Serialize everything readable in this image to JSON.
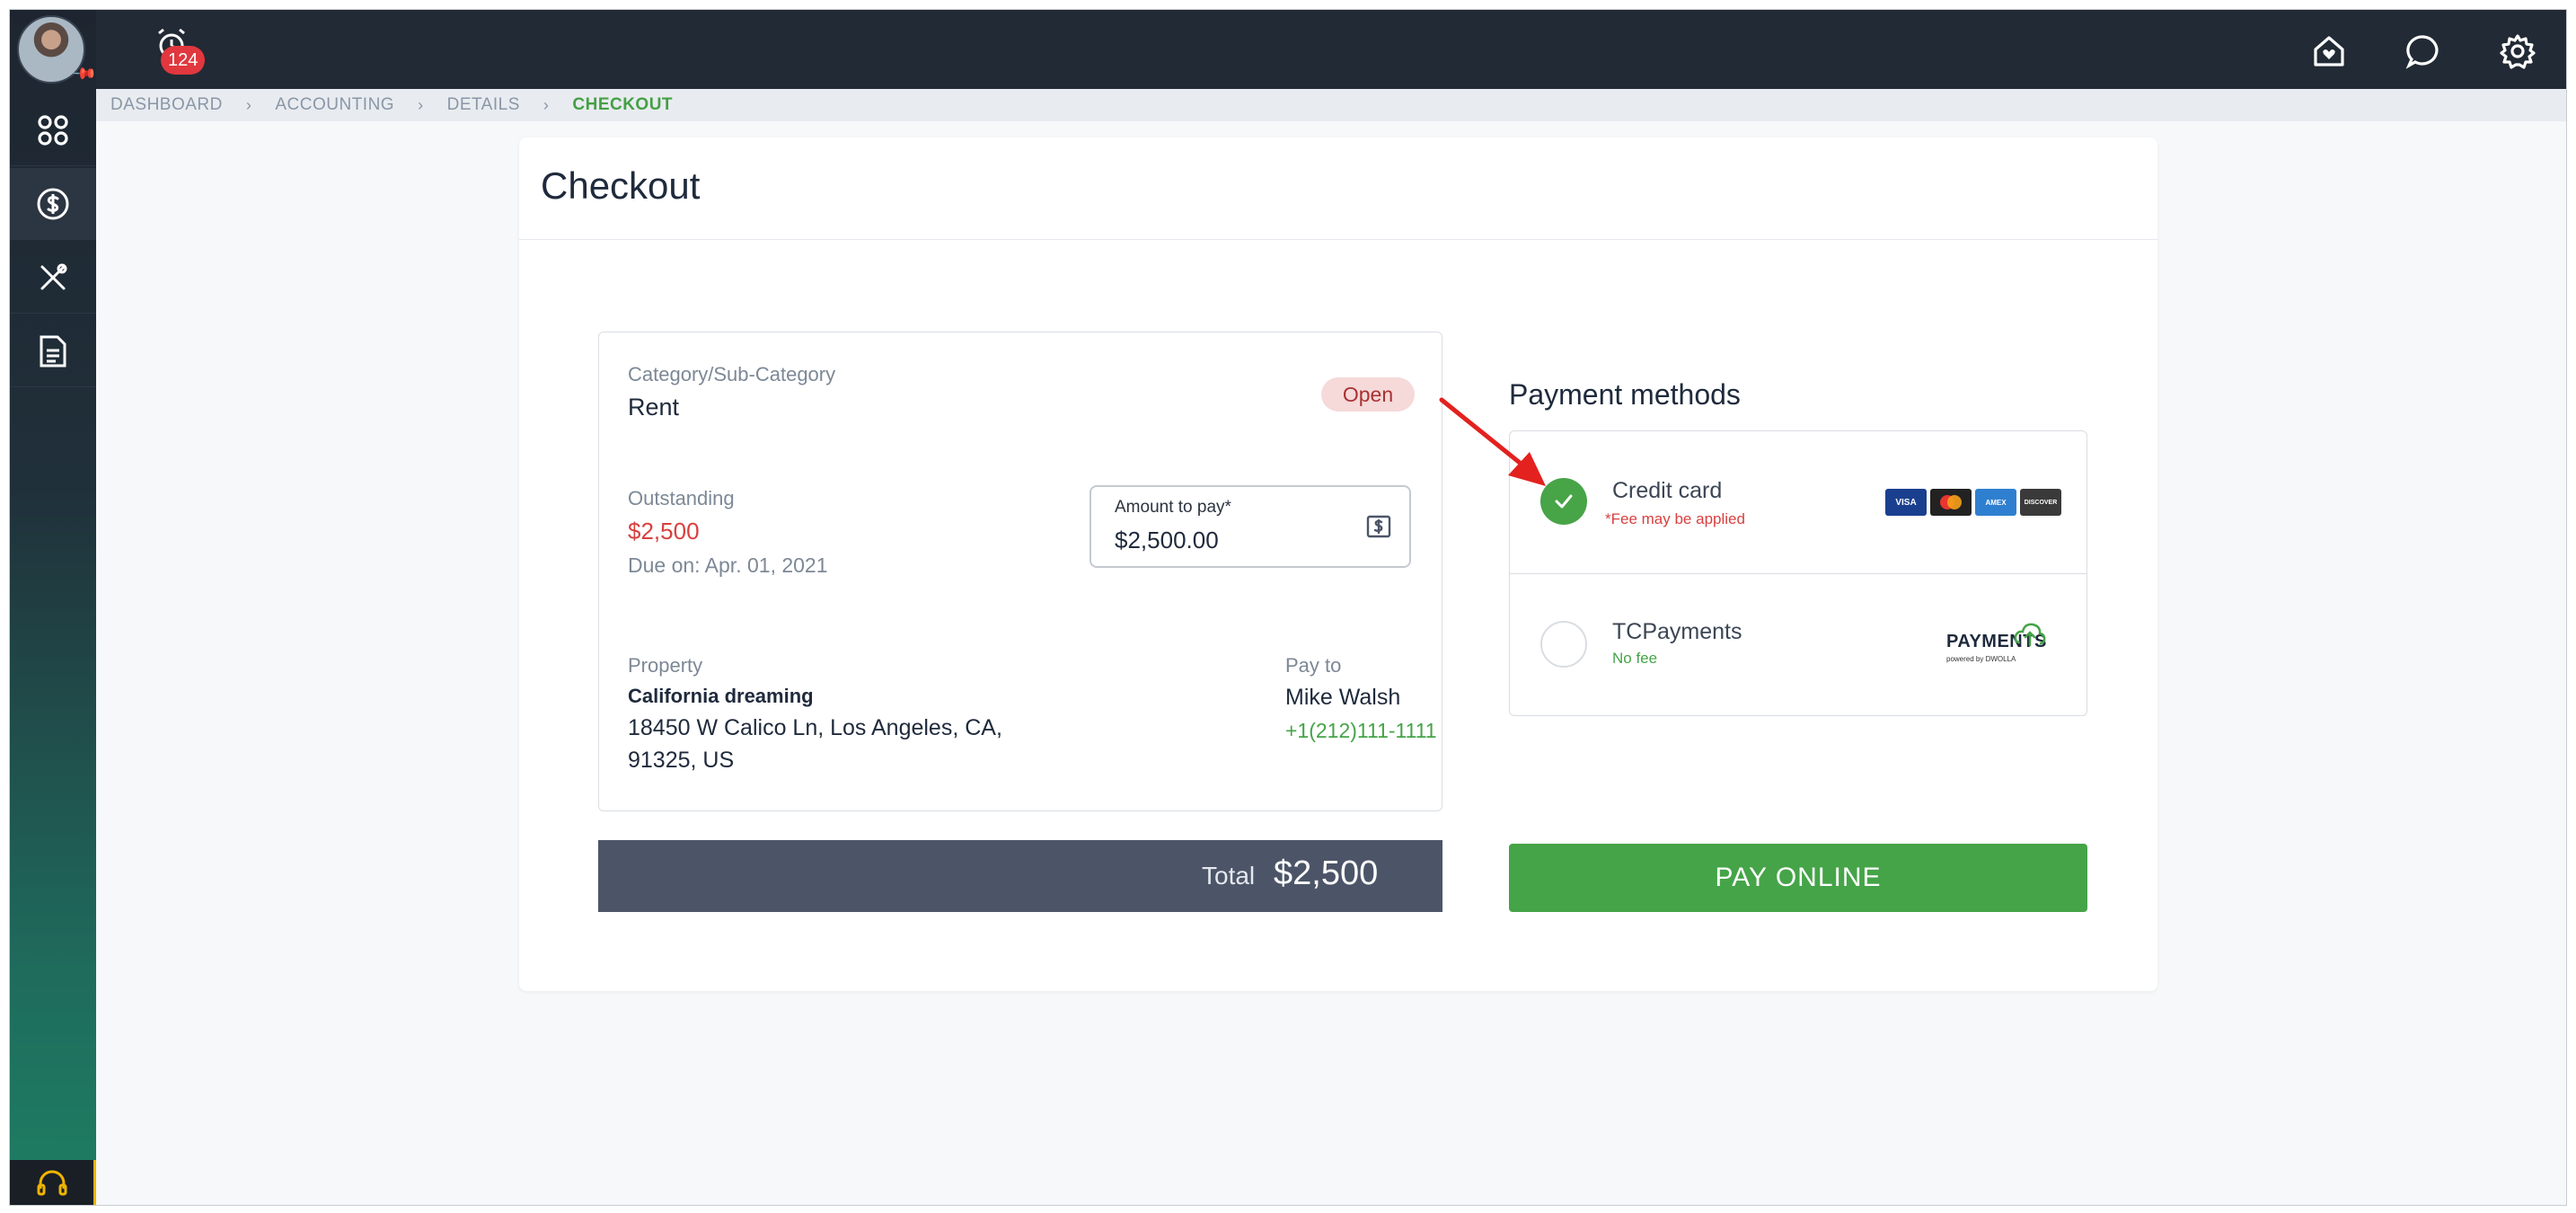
{
  "topbar": {
    "alarm_count": "124"
  },
  "breadcrumb": [
    "DASHBOARD",
    "ACCOUNTING",
    "DETAILS",
    "CHECKOUT"
  ],
  "page": {
    "title": "Checkout"
  },
  "detail": {
    "category_label": "Category/Sub-Category",
    "category_value": "Rent",
    "status": "Open",
    "outstanding_label": "Outstanding",
    "outstanding_value": "$2,500",
    "due": "Due on: Apr. 01, 2021",
    "amount_label": "Amount to pay*",
    "amount_value": "$2,500.00",
    "property_label": "Property",
    "property_name": "California dreaming",
    "property_address_line1": "18450 W Calico Ln, Los Angeles, CA,",
    "property_address_line2": "91325, US",
    "pay_to_label": "Pay to",
    "pay_to_name": "Mike Walsh",
    "pay_to_phone": "+1(212)111-1111"
  },
  "total": {
    "label": "Total",
    "value": "$2,500"
  },
  "payment_methods": {
    "title": "Payment methods",
    "options": [
      {
        "name": "Credit card",
        "asterisk": "*",
        "note": "Fee may be applied",
        "selected": true
      },
      {
        "name": "TCPayments",
        "note": "No fee",
        "selected": false
      }
    ],
    "card_logos": [
      "VISA",
      "MC",
      "AMEX",
      "DISCOVER"
    ],
    "tcpayments_logo": {
      "word": "PAYMENTS",
      "powered": "powered by DWOLLA"
    }
  },
  "pay_button": "PAY ONLINE",
  "colors": {
    "accent_green": "#45a448",
    "danger_red": "#d8403f",
    "sidebar_dark": "#1e2530",
    "topbar": "#222a35",
    "total_bar": "#4c5568"
  }
}
